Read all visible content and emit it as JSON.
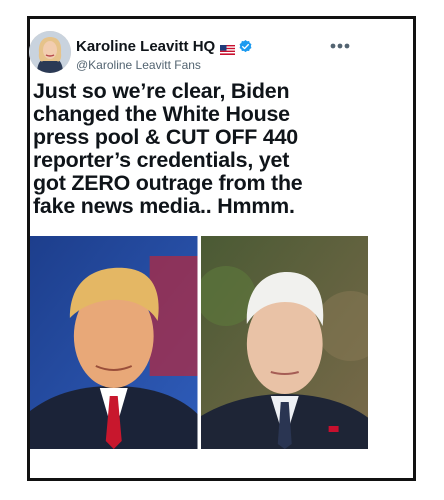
{
  "tweet": {
    "display_name": "Karoline Leavitt HQ",
    "handle": "@Karoline Leavitt Fans",
    "flag_icon": "us-flag-icon",
    "verified_icon": "verified-badge-icon",
    "more_icon": "more-options-icon",
    "text": "Just so we’re clear, Biden\nchanged the White House\npress pool & CUT OFF 440\nreporter’s credentials, yet\ngot ZERO outrage from the\nfake news media.. Hmmm."
  },
  "colors": {
    "verified_blue": "#1d9bf0",
    "text_primary": "#0f1419",
    "text_secondary": "#536471",
    "border": "#111111"
  }
}
